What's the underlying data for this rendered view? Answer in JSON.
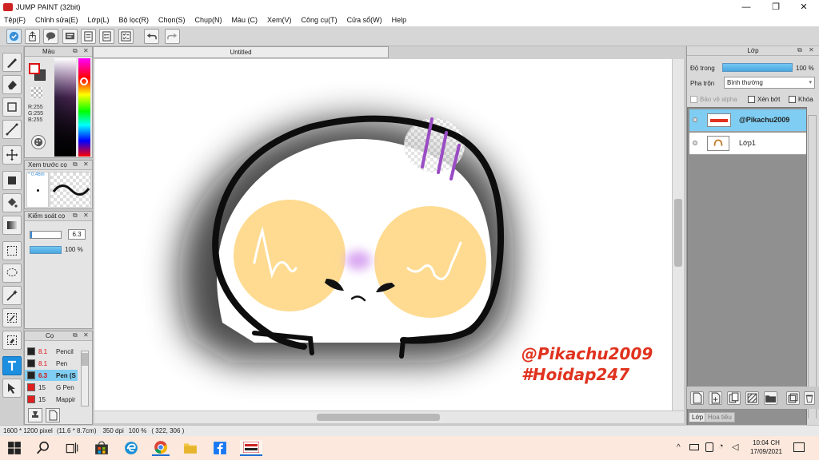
{
  "window": {
    "title": "JUMP PAINT (32bit)",
    "minimize": "—",
    "maximize": "❐",
    "close": "✕"
  },
  "menu": [
    "Tệp(F)",
    "Chỉnh sửa(E)",
    "Lớp(L)",
    "Bộ lọc(R)",
    "Chọn(S)",
    "Chụp(N)",
    "Màu (C)",
    "Xem(V)",
    "Công cụ(T)",
    "Cửa sổ(W)",
    "Help"
  ],
  "document": {
    "tab_label": "Untitled"
  },
  "color_panel": {
    "title": "Màu",
    "rgb": {
      "r": "R:255",
      "g": "G:255",
      "b": "B:255"
    },
    "primary_color": "#ffffff",
    "secondary_color": "#444444"
  },
  "brush_preview": {
    "title": "Xem trước cọ",
    "size_label": "* 0.46m"
  },
  "brush_control": {
    "title": "Kiểm soát cọ",
    "size_value": "6.3",
    "opacity_value": "100 %"
  },
  "brushes": {
    "title": "Cọ",
    "items": [
      {
        "size": "8.1",
        "name": "Pencil",
        "color": "#222222"
      },
      {
        "size": "8.1",
        "name": "Pen",
        "color": "#222222"
      },
      {
        "size": "6.3",
        "name": "Pen (S",
        "color": "#222222",
        "selected": true
      },
      {
        "size": "15",
        "name": "G Pen",
        "color": "#e02020"
      },
      {
        "size": "15",
        "name": "Mappir",
        "color": "#e02020"
      }
    ]
  },
  "layers_panel": {
    "title": "Lớp",
    "opacity_label": "Độ trong",
    "opacity_value": "100 %",
    "blend_label": "Pha trộn",
    "blend_value": "Bình thường",
    "protect_alpha": "Bảo vệ alpha",
    "clipping": "Xén bớt",
    "lock": "Khóa",
    "layers": [
      {
        "name": "@Pikachu2009",
        "selected": true
      },
      {
        "name": "Lớp1",
        "selected": false
      }
    ],
    "tabs": [
      "Lớp",
      "Hoa tiêu"
    ]
  },
  "canvas_text": {
    "line1": "@Pikachu2009",
    "line2": "#Hoidap247",
    "text_color": "#e0321e"
  },
  "status": {
    "size": "1600 * 1200 pixel",
    "physical": "(11.6 * 8.7cm)",
    "dpi": "350 dpi",
    "zoom": "100 %",
    "coords": "( 322, 306 )"
  },
  "taskbar": {
    "time": "10:04 CH",
    "date": "17/09/2021"
  }
}
